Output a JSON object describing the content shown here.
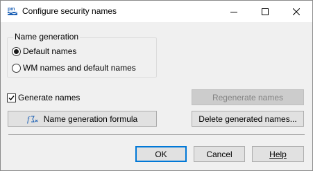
{
  "window": {
    "title": "Configure security names",
    "app_icon": "pm-logo-icon",
    "controls": [
      "minimize-icon",
      "maximize-icon",
      "close-icon"
    ]
  },
  "name_generation": {
    "legend": "Name generation",
    "options": [
      {
        "label": "Default names",
        "selected": true
      },
      {
        "label": "WM names and default names",
        "selected": false
      }
    ]
  },
  "generate_names": {
    "label": "Generate names",
    "checked": true
  },
  "buttons": {
    "regenerate": {
      "label": "Regenerate names",
      "enabled": false
    },
    "formula": {
      "label": "Name generation formula",
      "icon": "formula-icon"
    },
    "delete_generated": {
      "label": "Delete generated names..."
    },
    "ok": "OK",
    "cancel": "Cancel",
    "help": "Help"
  },
  "colors": {
    "accent": "#0078d7",
    "dialog_bg": "#f0f0f0",
    "disabled_text": "#838383"
  }
}
